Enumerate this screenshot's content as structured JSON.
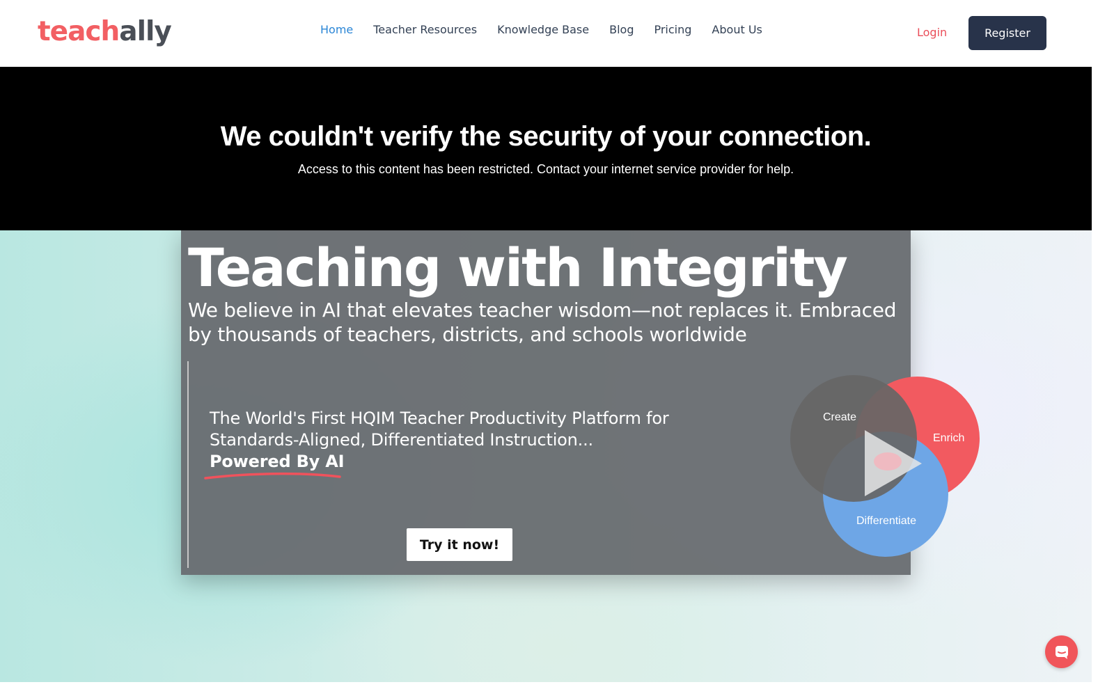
{
  "header": {
    "logo": {
      "part1": "teach",
      "part2": "ally"
    },
    "nav": [
      {
        "label": "Home"
      },
      {
        "label": "Teacher Resources"
      },
      {
        "label": "Knowledge Base"
      },
      {
        "label": "Blog"
      },
      {
        "label": "Pricing"
      },
      {
        "label": "About Us"
      }
    ],
    "login_label": "Login",
    "register_label": "Register"
  },
  "banner": {
    "title": "We couldn't verify the security of your connection.",
    "message": "Access to this content has been restricted. Contact your internet service provider for help."
  },
  "hero": {
    "title": "Teaching with Integrity",
    "subtitle": "We believe in AI that elevates teacher wisdom—not replaces it. Embraced by thousands of teachers, districts, and schools worldwide",
    "tagline_line1": "The World's First HQIM Teacher Productivity Platform for",
    "tagline_line2": "Standards-Aligned, Differentiated Instruction...",
    "tagline_powered": "Powered By AI",
    "cta_label": "Try it now!",
    "venn": {
      "create": "Create",
      "enrich": "Enrich",
      "differentiate": "Differentiate"
    }
  },
  "colors": {
    "brand_red": "#f25f63",
    "nav_active": "#2b86d6",
    "register_bg": "#28334a",
    "venn_gray": "#666666",
    "venn_red": "#f25a60",
    "venn_blue": "#6ea6e6"
  },
  "icons": {
    "play": "play-icon",
    "chat": "chat-icon"
  }
}
